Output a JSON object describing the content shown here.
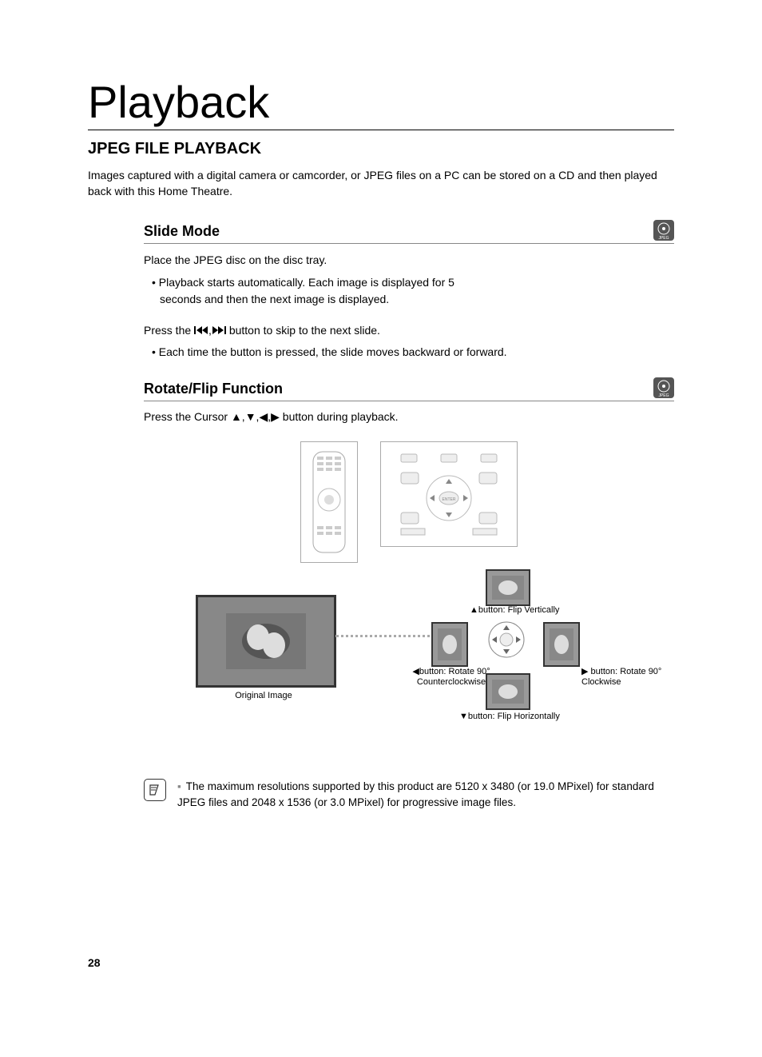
{
  "chapter_title": "Playback",
  "section_title": "JPEG FILE PLAYBACK",
  "intro": "Images captured with a digital camera or camcorder, or JPEG files on a PC can be stored on a CD and then played back with this Home Theatre.",
  "slide_mode": {
    "heading": "Slide Mode",
    "line1": "Place the JPEG disc on the disc tray.",
    "bullet1": "• Playback starts automatically. Each image is displayed for 5 seconds and then the next image is displayed.",
    "press_prefix": "Press the ",
    "press_suffix": " button to skip to the next slide.",
    "bullet2": "• Each time the button is pressed, the slide moves backward or forward."
  },
  "rotate_flip": {
    "heading": "Rotate/Flip Function",
    "press_prefix": "Press the Cursor ",
    "press_suffix": " button during playback."
  },
  "diagram": {
    "original_caption": "Original Image",
    "up_label": "button: Flip Vertically",
    "left_label_a": "button: Rotate 90°",
    "left_label_b": "Counterclockwise",
    "right_label_a": "button: Rotate 90°",
    "right_label_b": "Clockwise",
    "down_label": "button: Flip Horizontally"
  },
  "note": "The maximum resolutions supported by this product are 5120 x 3480 (or 19.0 MPixel) for standard JPEG files and 2048 x 1536 (or 3.0 MPixel) for progressive image files.",
  "page_number": "28",
  "badge_label": "JPEG"
}
